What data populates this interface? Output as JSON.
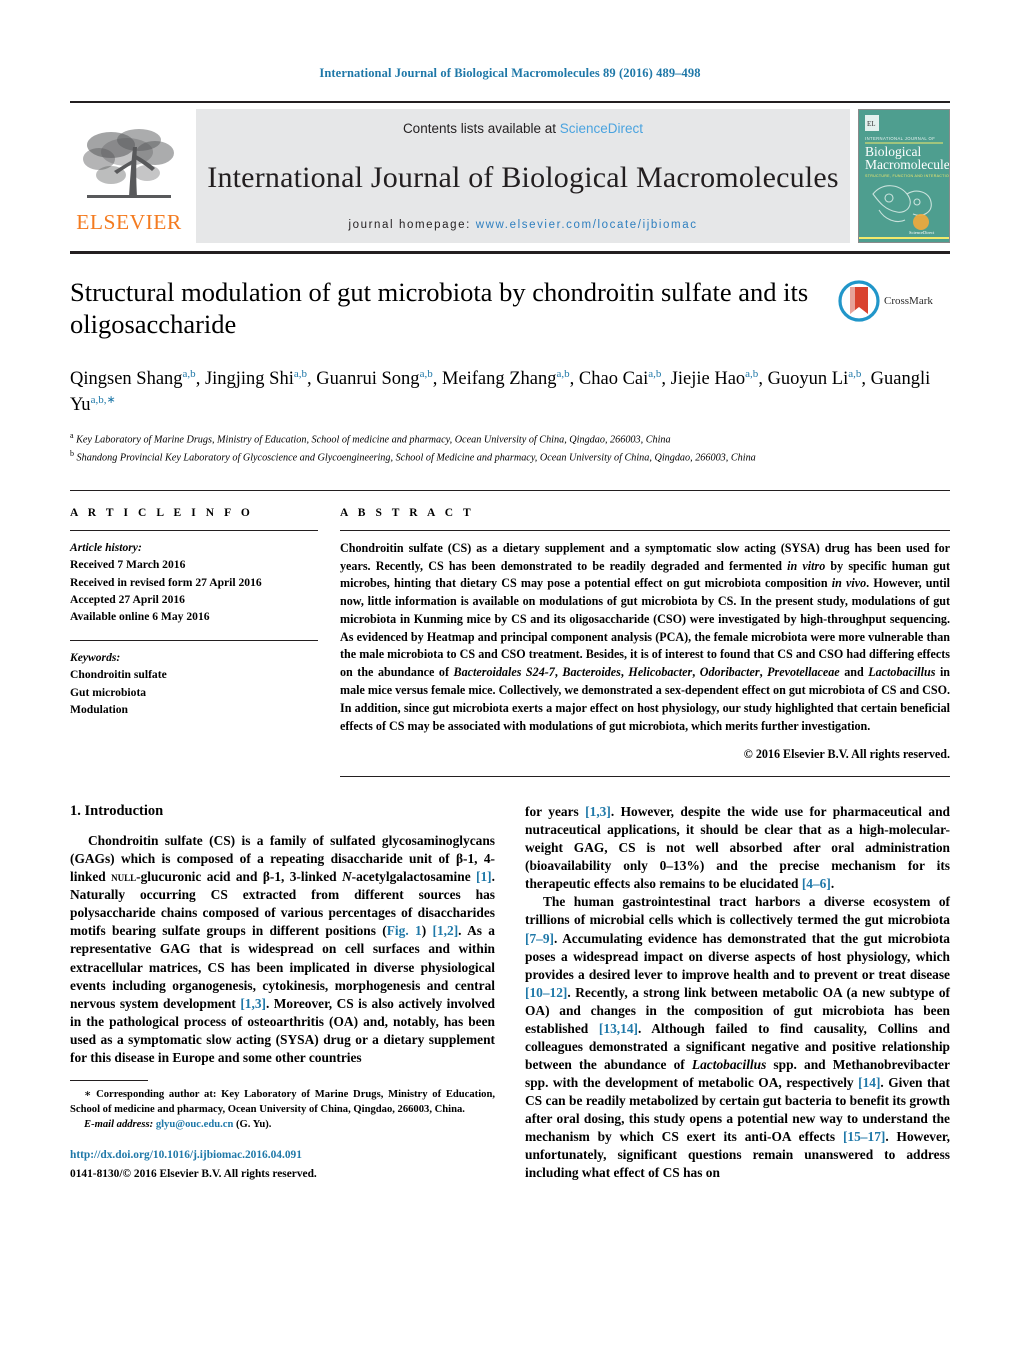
{
  "running_head": "International Journal of Biological Macromolecules 89 (2016) 489–498",
  "masthead": {
    "publisher_wordmark": "ELSEVIER",
    "contents_prefix": "Contents lists available at ",
    "contents_link": "ScienceDirect",
    "journal_title": "International Journal of Biological Macromolecules",
    "homepage_prefix": "journal homepage: ",
    "homepage_url": "www.elsevier.com/locate/ijbiomac",
    "cover": {
      "overline": "INTERNATIONAL JOURNAL OF",
      "line1": "Biological",
      "line2": "Macromolecules",
      "subtitle": "STRUCTURE, FUNCTION AND INTERACTIONS",
      "footer": "ScienceDirect",
      "footer_sub": "www.sciencedirect.com"
    },
    "accent_link_color": "#4aa3df",
    "url_color": "#2e7fbf",
    "elsevier_orange": "#f47b20",
    "cover_green": "#4e9e8f"
  },
  "article": {
    "title": "Structural modulation of gut microbiota by chondroitin sulfate and its oligosaccharide",
    "crossmark_label": "CrossMark",
    "authors": [
      {
        "name": "Qingsen Shang",
        "sup": "a,b",
        "sep": ", "
      },
      {
        "name": "Jingjing Shi",
        "sup": "a,b",
        "sep": ", "
      },
      {
        "name": "Guanrui Song",
        "sup": "a,b",
        "sep": ", "
      },
      {
        "name": "Meifang Zhang",
        "sup": "a,b",
        "sep": ", "
      },
      {
        "name": "Chao Cai",
        "sup": "a,b",
        "sep": ", "
      },
      {
        "name": "Jiejie Hao",
        "sup": "a,b",
        "sep": ", "
      },
      {
        "name": "Guoyun Li",
        "sup": "a,b",
        "sep": ", "
      },
      {
        "name": "Guangli Yu",
        "sup": "a,b,∗",
        "sep": ""
      }
    ],
    "affiliations": [
      {
        "marker": "a",
        "text": "Key Laboratory of Marine Drugs, Ministry of Education, School of medicine and pharmacy, Ocean University of China, Qingdao, 266003, China"
      },
      {
        "marker": "b",
        "text": "Shandong Provincial Key Laboratory of Glycoscience and Glycoengineering, School of Medicine and pharmacy, Ocean University of China, Qingdao, 266003, China"
      }
    ]
  },
  "article_info": {
    "heading": "A R T I C L E   I N F O",
    "history_label": "Article history:",
    "history": [
      "Received 7 March 2016",
      "Received in revised form 27 April 2016",
      "Accepted 27 April 2016",
      "Available online 6 May 2016"
    ],
    "keywords_label": "Keywords:",
    "keywords": [
      "Chondroitin sulfate",
      "Gut microbiota",
      "Modulation"
    ]
  },
  "abstract": {
    "heading": "A B S T R A C T",
    "paragraph_html": "Chondroitin sulfate (CS) as a dietary supplement and a symptomatic slow acting (SYSA) drug has been used for years. Recently, CS has been demonstrated to be readily degraded and fermented <i>in vitro</i> by specific human gut microbes, hinting that dietary CS may pose a potential effect on gut microbiota composition <i>in vivo</i>. However, until now, little information is available on modulations of gut microbiota by CS. In the present study, modulations of gut microbiota in Kunming mice by CS and its oligosaccharide (CSO) were investigated by high-throughput sequencing. As evidenced by Heatmap and principal component analysis (PCA), the female microbiota were more vulnerable than the male microbiota to CS and CSO treatment. Besides, it is of interest to found that CS and CSO had differing effects on the abundance of <i>Bacteroidales S24-7</i>, <i>Bacteroides</i>, <i>Helicobacter</i>, <i>Odoribacter</i>, <i>Prevotellaceae</i> and <i>Lactobacillus</i> in male mice versus female mice. Collectively, we demonstrated a sex-dependent effect on gut microbiota of CS and CSO. In addition, since gut microbiota exerts a major effect on host physiology, our study highlighted that certain beneficial effects of CS may be associated with modulations of gut microbiota, which merits further investigation.",
    "copyright": "© 2016 Elsevier B.V. All rights reserved."
  },
  "introduction": {
    "section_number_title": "1. Introduction",
    "left_paragraph_html": "Chondroitin sulfate (CS) is a family of sulfated glycosaminoglycans (GAGs) which is composed of a repeating disaccharide unit of β-1, 4-linked <span class=\"sc\">null</span>-glucuronic acid and β-1, 3-linked <i>N</i>-acetylgalactosamine <span class=\"ref\">[1]</span>. Naturally occurring CS extracted from different sources has polysaccharide chains composed of various percentages of disaccharides motifs bearing sulfate groups in different positions (<span class=\"ref\">Fig. 1</span>) <span class=\"ref\">[1,2]</span>. As a representative GAG that is widespread on cell surfaces and within extracellular matrices, CS has been implicated in diverse physiological events including organogenesis, cytokinesis, morphogenesis and central nervous system development <span class=\"ref\">[1,3]</span>. Moreover, CS is also actively involved in the pathological process of osteoarthritis (OA) and, notably, has been used as a symptomatic slow acting (SYSA) drug or a dietary supplement for this disease in Europe and some other countries",
    "right_paragraph1_html": "for years <span class=\"ref\">[1,3]</span>. However, despite the wide use for pharmaceutical and nutraceutical applications, it should be clear that as a high-molecular-weight GAG, CS is not well absorbed after oral administration (bioavailability only 0–13%) and the precise mechanism for its therapeutic effects also remains to be elucidated <span class=\"ref\">[4–6]</span>.",
    "right_paragraph2_html": "The human gastrointestinal tract harbors a diverse ecosystem of trillions of microbial cells which is collectively termed the gut microbiota <span class=\"ref\">[7–9]</span>. Accumulating evidence has demonstrated that the gut microbiota poses a widespread impact on diverse aspects of host physiology, which provides a desired lever to improve health and to prevent or treat disease <span class=\"ref\">[10–12]</span>. Recently, a strong link between metabolic OA (a new subtype of OA) and changes in the composition of gut microbiota has been established <span class=\"ref\">[13,14]</span>. Although failed to find causality, Collins and colleagues demonstrated a significant negative and positive relationship between the abundance of <i>Lactobacillus</i> spp. and Methanobrevibacter spp. with the development of metabolic OA, respectively <span class=\"ref\">[14]</span>. Given that CS can be readily metabolized by certain gut bacteria to benefit its growth after oral dosing, this study opens a potential new way to understand the mechanism by which CS exert its anti-OA effects <span class=\"ref\">[15–17]</span>. However, unfortunately, significant questions remain unanswered to address including what effect of CS has on"
  },
  "footer": {
    "corresponding_html": "<b>∗</b> Corresponding author at: Key Laboratory of Marine Drugs, Ministry of Education, School of medicine and pharmacy, Ocean University of China, Qingdao, 266003, China.",
    "email_label": "E-mail address:",
    "email": "glyu@ouc.edu.cn",
    "email_owner": "(G. Yu).",
    "doi_url": "http://dx.doi.org/10.1016/j.ijbiomac.2016.04.091",
    "issn_line": "0141-8130/© 2016 Elsevier B.V. All rights reserved."
  }
}
